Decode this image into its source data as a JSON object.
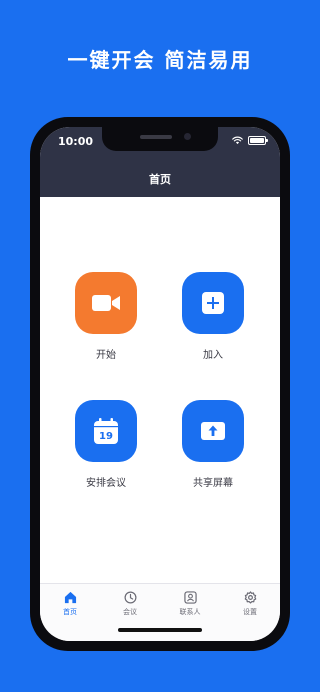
{
  "headline": "一键开会 简洁易用",
  "status_bar": {
    "time": "10:00"
  },
  "nav": {
    "title": "首页"
  },
  "actions": [
    {
      "label": "开始",
      "icon": "video-camera-icon",
      "color": "#f47a2f"
    },
    {
      "label": "加入",
      "icon": "plus-icon",
      "color": "#1a6ff0"
    },
    {
      "label": "安排会议",
      "icon": "calendar-icon",
      "color": "#1a6ff0",
      "calendar_day": "19"
    },
    {
      "label": "共享屏幕",
      "icon": "share-screen-icon",
      "color": "#1a6ff0"
    }
  ],
  "tabs": [
    {
      "label": "首页",
      "icon": "home-icon",
      "active": true
    },
    {
      "label": "会议",
      "icon": "clock-icon",
      "active": false
    },
    {
      "label": "联系人",
      "icon": "contacts-icon",
      "active": false
    },
    {
      "label": "设置",
      "icon": "gear-icon",
      "active": false
    }
  ],
  "colors": {
    "background": "#1a6ff0",
    "accent": "#1a6ff0",
    "start_orange": "#f47a2f",
    "header_dark": "#2f3346"
  }
}
